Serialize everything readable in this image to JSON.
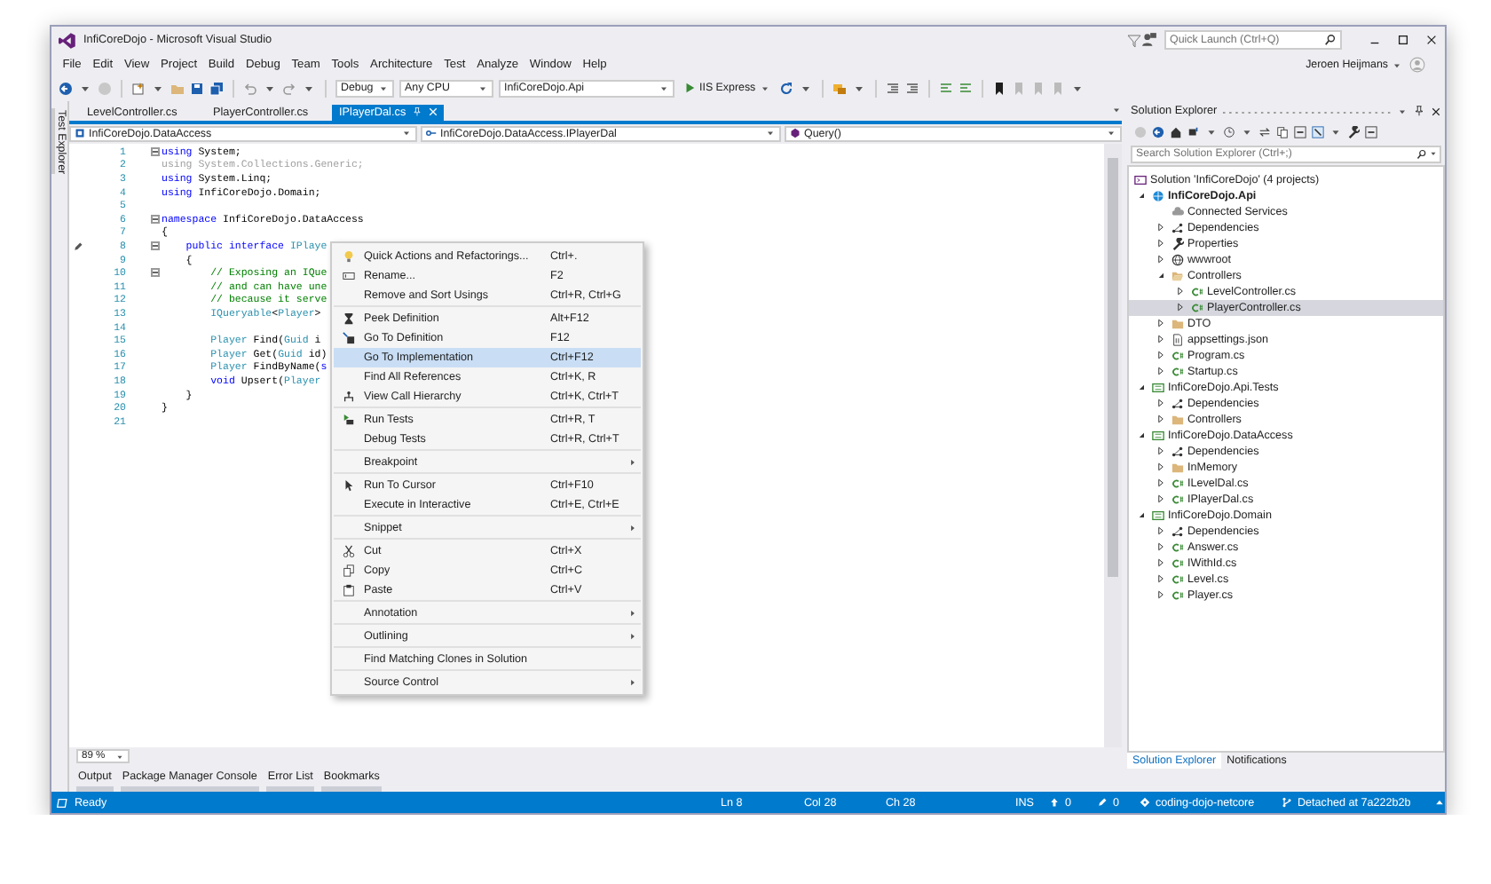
{
  "window": {
    "title": "InfiCoreDojo - Microsoft Visual Studio"
  },
  "quick_launch": {
    "placeholder": "Quick Launch (Ctrl+Q)"
  },
  "menu": [
    "File",
    "Edit",
    "View",
    "Project",
    "Build",
    "Debug",
    "Team",
    "Tools",
    "Architecture",
    "Test",
    "Analyze",
    "Window",
    "Help"
  ],
  "user": {
    "name": "Jeroen Heijmans"
  },
  "toolbar": {
    "dropdowns": [
      "Debug",
      "Any CPU",
      "InfiCoreDojo.Api"
    ],
    "run_button": "IIS Express"
  },
  "side_strip": {
    "label": "Test Explorer"
  },
  "editor": {
    "tabs": [
      {
        "label": "LevelController.cs",
        "selected": false
      },
      {
        "label": "PlayerController.cs",
        "selected": false
      },
      {
        "label": "IPlayerDal.cs",
        "selected": true
      }
    ],
    "nav": [
      "InfiCoreDojo.DataAccess",
      "InfiCoreDojo.DataAccess.IPlayerDal",
      "Query()"
    ],
    "lines": [
      {
        "number": "1",
        "fold": true,
        "pencil": false,
        "tokens": [
          {
            "kind": "keyword",
            "text": "using"
          },
          {
            "kind": "plain",
            "text": " System;"
          }
        ]
      },
      {
        "number": "2",
        "fold": false,
        "pencil": false,
        "tokens": [
          {
            "kind": "unused",
            "text": "using System.Collections.Generic;"
          }
        ]
      },
      {
        "number": "3",
        "fold": false,
        "pencil": false,
        "tokens": [
          {
            "kind": "keyword",
            "text": "using"
          },
          {
            "kind": "plain",
            "text": " System.Linq;"
          }
        ]
      },
      {
        "number": "4",
        "fold": false,
        "pencil": false,
        "tokens": [
          {
            "kind": "keyword",
            "text": "using"
          },
          {
            "kind": "plain",
            "text": " InfiCoreDojo.Domain;"
          }
        ]
      },
      {
        "number": "5",
        "fold": false,
        "pencil": false
      },
      {
        "number": "6",
        "fold": true,
        "pencil": false,
        "tokens": [
          {
            "kind": "keyword",
            "text": "namespace"
          },
          {
            "kind": "plain",
            "text": " InfiCoreDojo.DataAccess"
          }
        ]
      },
      {
        "number": "7",
        "fold": false,
        "pencil": false,
        "tokens": [
          {
            "kind": "plain",
            "text": "{"
          }
        ]
      },
      {
        "number": "8",
        "fold": true,
        "pencil": true,
        "tokens": [
          {
            "kind": "keyword",
            "text": "    public interface "
          },
          {
            "kind": "type",
            "text": "IPlaye"
          }
        ]
      },
      {
        "number": "9",
        "fold": false,
        "pencil": false,
        "tokens": [
          {
            "kind": "plain",
            "text": "    {"
          }
        ]
      },
      {
        "number": "10",
        "fold": true,
        "pencil": false,
        "tokens": [
          {
            "kind": "comment",
            "text": "        // Exposing an IQue"
          }
        ]
      },
      {
        "number": "11",
        "fold": false,
        "pencil": false,
        "tokens": [
          {
            "kind": "comment",
            "text": "        // and can have une"
          }
        ]
      },
      {
        "number": "12",
        "fold": false,
        "pencil": false,
        "tokens": [
          {
            "kind": "comment",
            "text": "        // because it serve"
          }
        ]
      },
      {
        "number": "13",
        "fold": false,
        "pencil": false,
        "tokens": [
          {
            "kind": "type",
            "text": "        IQueryable"
          },
          {
            "kind": "plain",
            "text": "<"
          },
          {
            "kind": "type",
            "text": "Player"
          },
          {
            "kind": "plain",
            "text": ">"
          }
        ]
      },
      {
        "number": "14",
        "fold": false,
        "pencil": false
      },
      {
        "number": "15",
        "fold": false,
        "pencil": false,
        "tokens": [
          {
            "kind": "type",
            "text": "        Player"
          },
          {
            "kind": "plain",
            "text": " Find("
          },
          {
            "kind": "type",
            "text": "Guid"
          },
          {
            "kind": "plain",
            "text": " i"
          }
        ]
      },
      {
        "number": "16",
        "fold": false,
        "pencil": false,
        "tokens": [
          {
            "kind": "type",
            "text": "        Player"
          },
          {
            "kind": "plain",
            "text": " Get("
          },
          {
            "kind": "type",
            "text": "Guid"
          },
          {
            "kind": "plain",
            "text": " id)"
          }
        ]
      },
      {
        "number": "17",
        "fold": false,
        "pencil": false,
        "tokens": [
          {
            "kind": "type",
            "text": "        Player"
          },
          {
            "kind": "plain",
            "text": " FindByName("
          },
          {
            "kind": "keyword",
            "text": "s"
          }
        ]
      },
      {
        "number": "18",
        "fold": false,
        "pencil": false,
        "tokens": [
          {
            "kind": "keyword",
            "text": "        void"
          },
          {
            "kind": "plain",
            "text": " Upsert("
          },
          {
            "kind": "type",
            "text": "Player"
          }
        ]
      },
      {
        "number": "19",
        "fold": false,
        "pencil": false,
        "tokens": [
          {
            "kind": "plain",
            "text": "    }"
          }
        ]
      },
      {
        "number": "20",
        "fold": false,
        "pencil": false,
        "tokens": [
          {
            "kind": "plain",
            "text": "}"
          }
        ]
      },
      {
        "number": "21",
        "fold": false,
        "pencil": false
      }
    ],
    "zoom": "89 %"
  },
  "context_menu": {
    "groups": [
      {
        "items": [
          {
            "label": "Quick Actions and Refactorings...",
            "shortcut": "Ctrl+.",
            "submenu": false,
            "selected": false
          },
          {
            "label": "Rename...",
            "shortcut": "F2",
            "submenu": false,
            "selected": false
          },
          {
            "label": "Remove and Sort Usings",
            "shortcut": "Ctrl+R, Ctrl+G",
            "submenu": false,
            "selected": false
          }
        ]
      },
      {
        "items": [
          {
            "label": "Peek Definition",
            "shortcut": "Alt+F12",
            "submenu": false,
            "selected": false
          },
          {
            "label": "Go To Definition",
            "shortcut": "F12",
            "submenu": false,
            "selected": false
          },
          {
            "label": "Go To Implementation",
            "shortcut": "Ctrl+F12",
            "submenu": false,
            "selected": true
          },
          {
            "label": "Find All References",
            "shortcut": "Ctrl+K, R",
            "submenu": false,
            "selected": false
          },
          {
            "label": "View Call Hierarchy",
            "shortcut": "Ctrl+K, Ctrl+T",
            "submenu": false,
            "selected": false
          }
        ]
      },
      {
        "items": [
          {
            "label": "Run Tests",
            "shortcut": "Ctrl+R, T",
            "submenu": false,
            "selected": false
          },
          {
            "label": "Debug Tests",
            "shortcut": "Ctrl+R, Ctrl+T",
            "submenu": false,
            "selected": false
          }
        ]
      },
      {
        "items": [
          {
            "label": "Breakpoint",
            "submenu": true,
            "selected": false
          }
        ]
      },
      {
        "items": [
          {
            "label": "Run To Cursor",
            "shortcut": "Ctrl+F10",
            "submenu": false,
            "selected": false
          },
          {
            "label": "Execute in Interactive",
            "shortcut": "Ctrl+E, Ctrl+E",
            "submenu": false,
            "selected": false
          }
        ]
      },
      {
        "items": [
          {
            "label": "Snippet",
            "submenu": true,
            "selected": false
          }
        ]
      },
      {
        "items": [
          {
            "label": "Cut",
            "shortcut": "Ctrl+X",
            "submenu": false,
            "selected": false
          },
          {
            "label": "Copy",
            "shortcut": "Ctrl+C",
            "submenu": false,
            "selected": false
          },
          {
            "label": "Paste",
            "shortcut": "Ctrl+V",
            "submenu": false,
            "selected": false
          }
        ]
      },
      {
        "items": [
          {
            "label": "Annotation",
            "submenu": true,
            "selected": false
          }
        ]
      },
      {
        "items": [
          {
            "label": "Outlining",
            "submenu": true,
            "selected": false
          }
        ]
      },
      {
        "items": [
          {
            "label": "Find Matching Clones in Solution",
            "submenu": false,
            "selected": false
          }
        ]
      },
      {
        "items": [
          {
            "label": "Source Control",
            "submenu": true,
            "selected": false
          }
        ]
      }
    ]
  },
  "solution_explorer": {
    "title": "Solution Explorer",
    "search": {
      "placeholder": "Search Solution Explorer (Ctrl+;)"
    },
    "tree": [
      {
        "label": "Solution 'InfiCoreDojo' (4 projects)",
        "kind": "solution",
        "selected": false,
        "children": [
          {
            "label": "InfiCoreDojo.Api",
            "kind": "webproject",
            "expanded": true,
            "startup": true,
            "selected": false,
            "children": [
              {
                "label": "Connected Services",
                "kind": "services",
                "selected": false
              },
              {
                "label": "Dependencies",
                "kind": "dependencies",
                "expanded": false,
                "selected": false
              },
              {
                "label": "Properties",
                "kind": "properties",
                "expanded": false,
                "selected": false
              },
              {
                "label": "wwwroot",
                "kind": "web",
                "expanded": false,
                "selected": false
              },
              {
                "label": "Controllers",
                "kind": "folder",
                "expanded": true,
                "selected": false,
                "children": [
                  {
                    "label": "LevelController.cs",
                    "kind": "csharp",
                    "expanded": false,
                    "selected": false
                  },
                  {
                    "label": "PlayerController.cs",
                    "kind": "csharp",
                    "expanded": false,
                    "selected": true
                  }
                ]
              },
              {
                "label": "DTO",
                "kind": "folder",
                "expanded": false,
                "selected": false
              },
              {
                "label": "appsettings.json",
                "kind": "json",
                "expanded": false,
                "selected": false
              },
              {
                "label": "Program.cs",
                "kind": "csharp",
                "expanded": false,
                "selected": false
              },
              {
                "label": "Startup.cs",
                "kind": "csharp",
                "expanded": false,
                "selected": false
              }
            ]
          },
          {
            "label": "InfiCoreDojo.Api.Tests",
            "kind": "project",
            "expanded": true,
            "startup": false,
            "selected": false,
            "children": [
              {
                "label": "Dependencies",
                "kind": "dependencies",
                "expanded": false,
                "selected": false
              },
              {
                "label": "Controllers",
                "kind": "folder",
                "expanded": false,
                "selected": false
              }
            ]
          },
          {
            "label": "InfiCoreDojo.DataAccess",
            "kind": "project",
            "expanded": true,
            "startup": false,
            "selected": false,
            "children": [
              {
                "label": "Dependencies",
                "kind": "dependencies",
                "expanded": false,
                "selected": false
              },
              {
                "label": "InMemory",
                "kind": "folder",
                "expanded": false,
                "selected": false
              },
              {
                "label": "ILevelDal.cs",
                "kind": "csharp",
                "expanded": false,
                "selected": false
              },
              {
                "label": "IPlayerDal.cs",
                "kind": "csharp",
                "expanded": false,
                "selected": false
              }
            ]
          },
          {
            "label": "InfiCoreDojo.Domain",
            "kind": "project",
            "expanded": true,
            "startup": false,
            "selected": false,
            "children": [
              {
                "label": "Dependencies",
                "kind": "dependencies",
                "expanded": false,
                "selected": false
              },
              {
                "label": "Answer.cs",
                "kind": "csharp",
                "expanded": false,
                "selected": false
              },
              {
                "label": "IWithId.cs",
                "kind": "csharp",
                "expanded": false,
                "selected": false
              },
              {
                "label": "Level.cs",
                "kind": "csharp",
                "expanded": false,
                "selected": false
              },
              {
                "label": "Player.cs",
                "kind": "csharp",
                "expanded": false,
                "selected": false
              }
            ]
          }
        ]
      }
    ],
    "tabs": [
      {
        "label": "Solution Explorer",
        "selected": true
      },
      {
        "label": "Notifications",
        "selected": false
      }
    ]
  },
  "tool_tabs": [
    "Output",
    "Package Manager Console",
    "Error List",
    "Bookmarks"
  ],
  "status_bar": {
    "message": "Ready",
    "cursor": [
      "Ln 8",
      "Col 28",
      "Ch 28"
    ],
    "mode": "INS",
    "pushes": "0",
    "changes": "0",
    "repository": "coding-dojo-netcore",
    "branch": "Detached at 7a222b2b"
  }
}
